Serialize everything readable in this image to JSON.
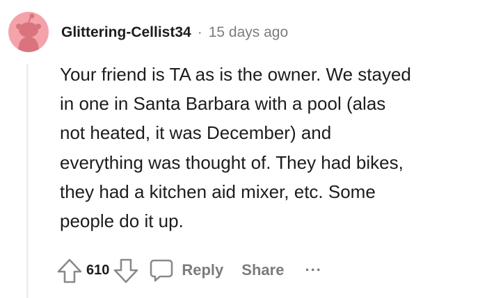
{
  "comment": {
    "author": "Glittering-Cellist34",
    "separator": "·",
    "timestamp": "15 days ago",
    "lines": [
      "Your friend is TA as is the owner. We stayed",
      "in one in Santa Barbara with a pool (alas",
      "not heated, it was December) and",
      "everything was thought of. They had bikes,",
      "they had a kitchen aid mixer, etc. Some",
      "people do it up."
    ],
    "votes": "610"
  },
  "actions": {
    "reply_label": "Reply",
    "share_label": "Share",
    "more_label": "..."
  },
  "icons": {
    "avatar": "snoo-avatar-icon",
    "upvote": "upvote-arrow-icon",
    "downvote": "downvote-arrow-icon",
    "reply": "comment-bubble-icon"
  },
  "colors": {
    "avatar_bg": "#f5a3ab",
    "text": "#1c1c1c",
    "meta": "#7c7c7c",
    "thread_line": "#edeff1"
  }
}
